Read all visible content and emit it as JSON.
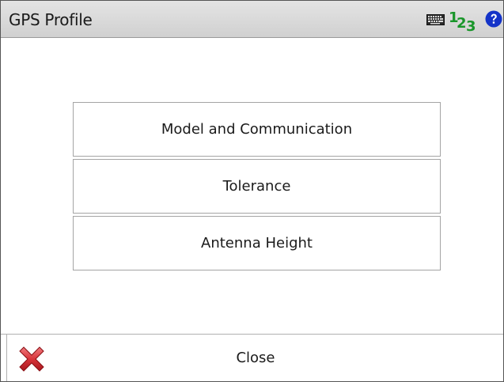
{
  "window": {
    "title": "GPS Profile"
  },
  "status_icons": {
    "keyboard_icon": "keyboard-icon",
    "input_mode_digits": [
      "1",
      "2",
      "3"
    ],
    "input_mode_color": "#19962a",
    "help_icon": "help-icon",
    "help_color": "#1433c8"
  },
  "menu": {
    "items": [
      {
        "label": "Model and Communication"
      },
      {
        "label": "Tolerance"
      },
      {
        "label": "Antenna Height"
      }
    ]
  },
  "footer": {
    "close_label": "Close",
    "close_icon": "close-x-icon",
    "close_icon_color": "#d8343a"
  }
}
